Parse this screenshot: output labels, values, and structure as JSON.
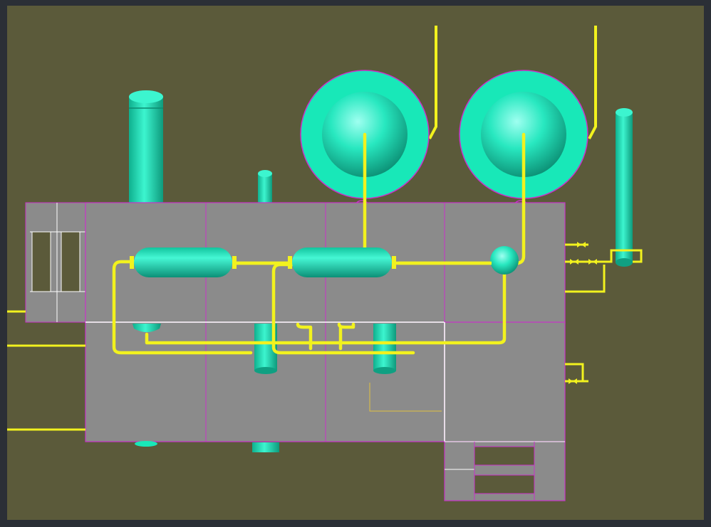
{
  "scene": {
    "type": "3D plant piping model view",
    "colors": {
      "frame": "#2b2f36",
      "viewport_background": "#5b5a3a",
      "steel_deck": "#8b8b8b",
      "deck_edge": "#c832c8",
      "deck_highlight": "#ffffff",
      "equipment": "#18e8b8",
      "equipment_dark": "#0fa082",
      "piping": "#f2f21e"
    },
    "equipment": [
      {
        "id": "spherical-tank-1",
        "kind": "sphere"
      },
      {
        "id": "spherical-tank-2",
        "kind": "sphere"
      },
      {
        "id": "tall-vertical-vessel",
        "kind": "vertical vessel"
      },
      {
        "id": "small-vertical-vessel",
        "kind": "vertical vessel"
      },
      {
        "id": "right-vertical-column",
        "kind": "vertical column"
      },
      {
        "id": "horizontal-drum-1",
        "kind": "horizontal drum"
      },
      {
        "id": "horizontal-drum-2",
        "kind": "horizontal drum"
      },
      {
        "id": "small-knockout-sphere",
        "kind": "small sphere"
      },
      {
        "id": "lower-vessel-1",
        "kind": "vertical vessel"
      },
      {
        "id": "lower-vessel-2",
        "kind": "vertical vessel"
      },
      {
        "id": "pot-vessel",
        "kind": "small pot"
      }
    ]
  }
}
